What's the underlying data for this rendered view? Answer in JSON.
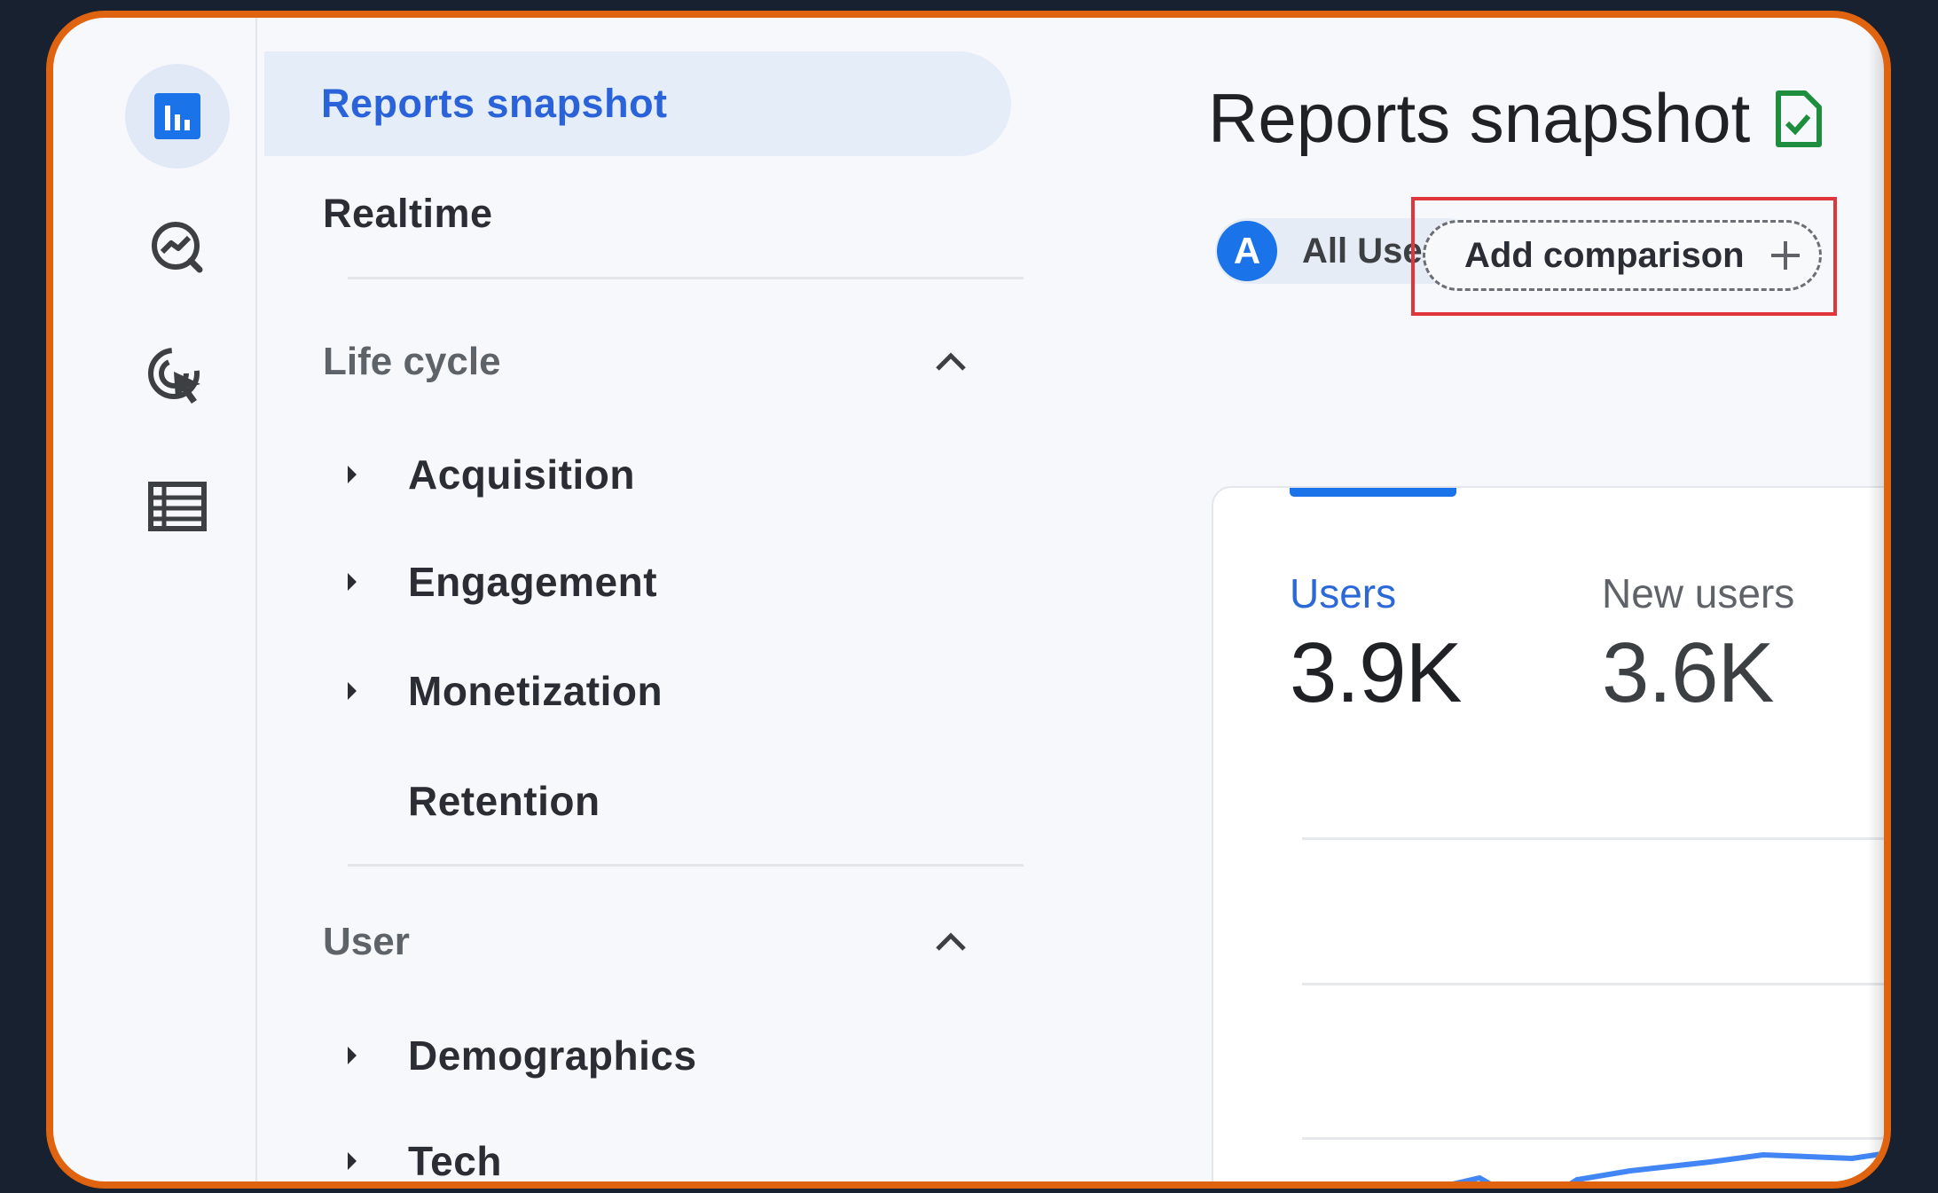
{
  "nav": {
    "active": "Reports snapshot",
    "realtime": "Realtime",
    "lifecycle": {
      "header": "Life cycle",
      "items": [
        "Acquisition",
        "Engagement",
        "Monetization",
        "Retention"
      ]
    },
    "user": {
      "header": "User",
      "items": [
        "Demographics",
        "Tech"
      ]
    }
  },
  "rail": {
    "icons": [
      "reports-bar-chart-icon",
      "explore-trend-icon",
      "advertising-cursor-icon",
      "configure-table-icon"
    ]
  },
  "main": {
    "title": "Reports snapshot",
    "title_icon": "document-check-icon",
    "segment": {
      "avatar": "A",
      "label": "All Users"
    },
    "add_comparison": "Add comparison",
    "metrics": [
      {
        "label": "Users",
        "value": "3.9K"
      },
      {
        "label": "New users",
        "value": "3.6K"
      }
    ]
  },
  "colors": {
    "accent": "#1a73e8",
    "frame_border": "#e0630f",
    "highlight": "#e0353b",
    "doc_icon": "#1e8e3e"
  }
}
